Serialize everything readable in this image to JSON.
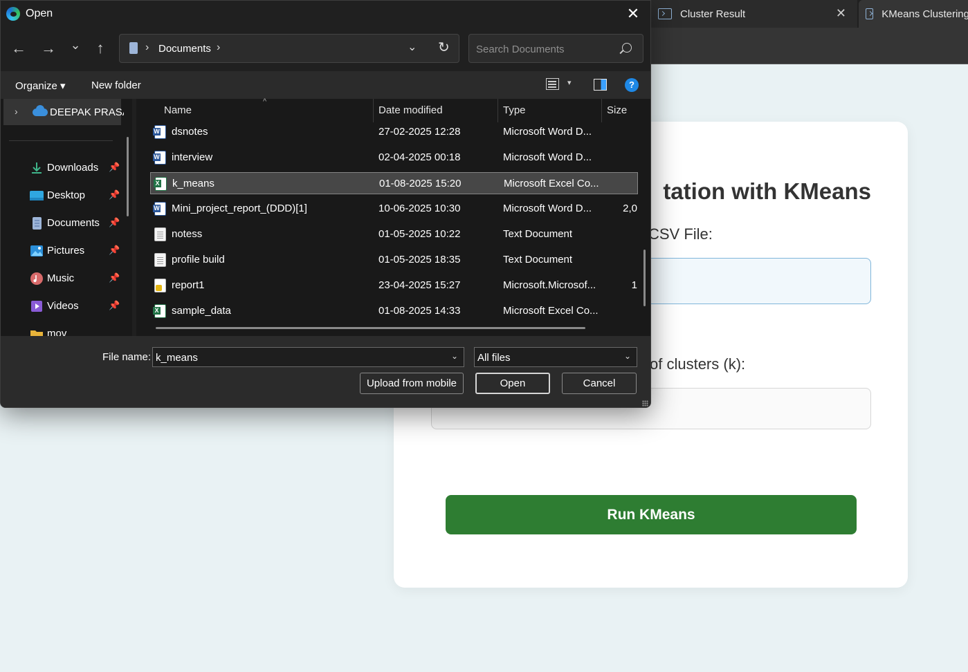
{
  "browser": {
    "tabs": [
      {
        "title": "Cluster Result",
        "close": "✕"
      },
      {
        "title": "KMeans Clustering"
      }
    ]
  },
  "page": {
    "title_visible": "tation with KMeans",
    "file_label_visible": "CSV File:",
    "k_label_visible": "of clusters (k):",
    "run_button": "Run KMeans"
  },
  "dialog": {
    "title": "Open",
    "close": "✕",
    "nav": {
      "back": "←",
      "forward": "→",
      "recent": "⌄",
      "up": "↑"
    },
    "path": {
      "segments": [
        "Documents"
      ],
      "separator": "›",
      "dropdown": "⌄",
      "refresh": "↻"
    },
    "search": {
      "placeholder": "Search Documents"
    },
    "commands": {
      "organize": "Organize ▾",
      "new_folder": "New folder",
      "help": "?",
      "view_menu": "▾"
    },
    "sidebar": {
      "cloud": {
        "label": "DEEPAK PRASATH",
        "chevron": "›"
      },
      "pin": "📌",
      "items": [
        {
          "label": "Downloads",
          "icon": "download-icon"
        },
        {
          "label": "Desktop",
          "icon": "desktop-folder-icon"
        },
        {
          "label": "Documents",
          "icon": "documents-folder-icon"
        },
        {
          "label": "Pictures",
          "icon": "pictures-folder-icon"
        },
        {
          "label": "Music",
          "icon": "music-folder-icon"
        },
        {
          "label": "Videos",
          "icon": "videos-folder-icon"
        },
        {
          "label": "mov",
          "icon": "folder-icon"
        }
      ]
    },
    "columns": {
      "name": "Name",
      "date": "Date modified",
      "type": "Type",
      "size": "Size",
      "sort_indicator": "^"
    },
    "files": [
      {
        "name": "dsnotes",
        "date": "27-02-2025 12:28",
        "type": "Microsoft Word D...",
        "size": "",
        "icon": "word"
      },
      {
        "name": "interview",
        "date": "02-04-2025 00:18",
        "type": "Microsoft Word D...",
        "size": "",
        "icon": "word"
      },
      {
        "name": "k_means",
        "date": "01-08-2025 15:20",
        "type": "Microsoft Excel Co...",
        "size": "",
        "icon": "excel",
        "selected": true
      },
      {
        "name": "Mini_project_report_(DDD)[1]",
        "date": "10-06-2025 10:30",
        "type": "Microsoft Word D...",
        "size": "2,0",
        "icon": "word"
      },
      {
        "name": "notess",
        "date": "01-05-2025 10:22",
        "type": "Text Document",
        "size": "",
        "icon": "text"
      },
      {
        "name": "profile build",
        "date": "01-05-2025 18:35",
        "type": "Text Document",
        "size": "",
        "icon": "text"
      },
      {
        "name": "report1",
        "date": "23-04-2025 15:27",
        "type": "Microsoft.Microsof...",
        "size": "1",
        "icon": "other"
      },
      {
        "name": "sample_data",
        "date": "01-08-2025 14:33",
        "type": "Microsoft Excel Co...",
        "size": "",
        "icon": "excel"
      }
    ],
    "bottom": {
      "file_name_label": "File name:",
      "file_name_value": "k_means",
      "file_type": "All files",
      "chevron": "⌄",
      "upload_button": "Upload from mobile",
      "open_button": "Open",
      "cancel_button": "Cancel"
    }
  }
}
